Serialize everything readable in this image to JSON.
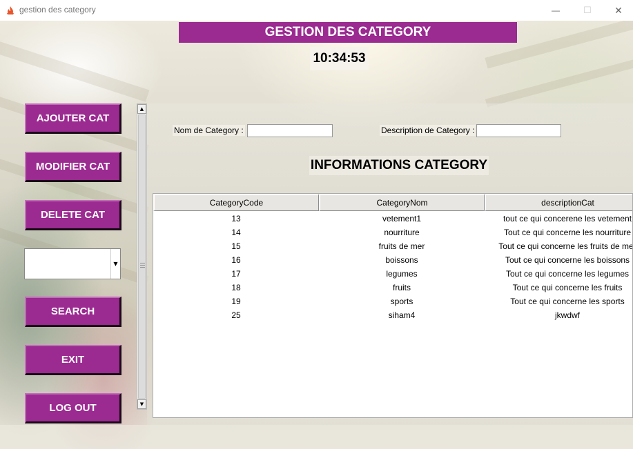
{
  "window": {
    "title": "gestion des category",
    "minimize_glyph": "—",
    "maximize_glyph": "☐",
    "close_glyph": "✕"
  },
  "header": {
    "banner": "GESTION DES CATEGORY",
    "clock": "10:34:53"
  },
  "buttons": {
    "add": "AJOUTER CAT",
    "modify": "MODIFIER CAT",
    "delete": "DELETE CAT",
    "search": "SEARCH",
    "exit": "EXIT",
    "logout": "LOG OUT"
  },
  "combo": {
    "value": ""
  },
  "form": {
    "name_label": "Nom de Category :",
    "name_value": "",
    "desc_label": "Description de  Category :",
    "desc_value": ""
  },
  "section_title": "INFORMATIONS CATEGORY",
  "table": {
    "columns": [
      "CategoryCode",
      "CategoryNom",
      "descriptionCat"
    ],
    "rows": [
      [
        "13",
        "vetement1",
        "tout ce qui concerene les vetement"
      ],
      [
        "14",
        "nourriture",
        "Tout ce qui concerne les nourriture"
      ],
      [
        "15",
        "fruits de mer",
        "Tout ce qui concerne les fruits de mer"
      ],
      [
        "16",
        "boissons",
        "Tout ce qui concerne les  boissons"
      ],
      [
        "17",
        "legumes",
        "Tout ce qui concerne les  legumes"
      ],
      [
        "18",
        "fruits",
        "Tout ce qui concerne les  fruits"
      ],
      [
        "19",
        "sports",
        "Tout ce qui concerne les  sports"
      ],
      [
        "25",
        "siham4",
        "jkwdwf"
      ]
    ]
  },
  "colors": {
    "accent": "#9b2a91"
  },
  "icons": {
    "app": "flame-icon",
    "combo_arrow": "chevron-down-icon",
    "scroll_up": "arrow-up-icon",
    "scroll_down": "arrow-down-icon"
  }
}
